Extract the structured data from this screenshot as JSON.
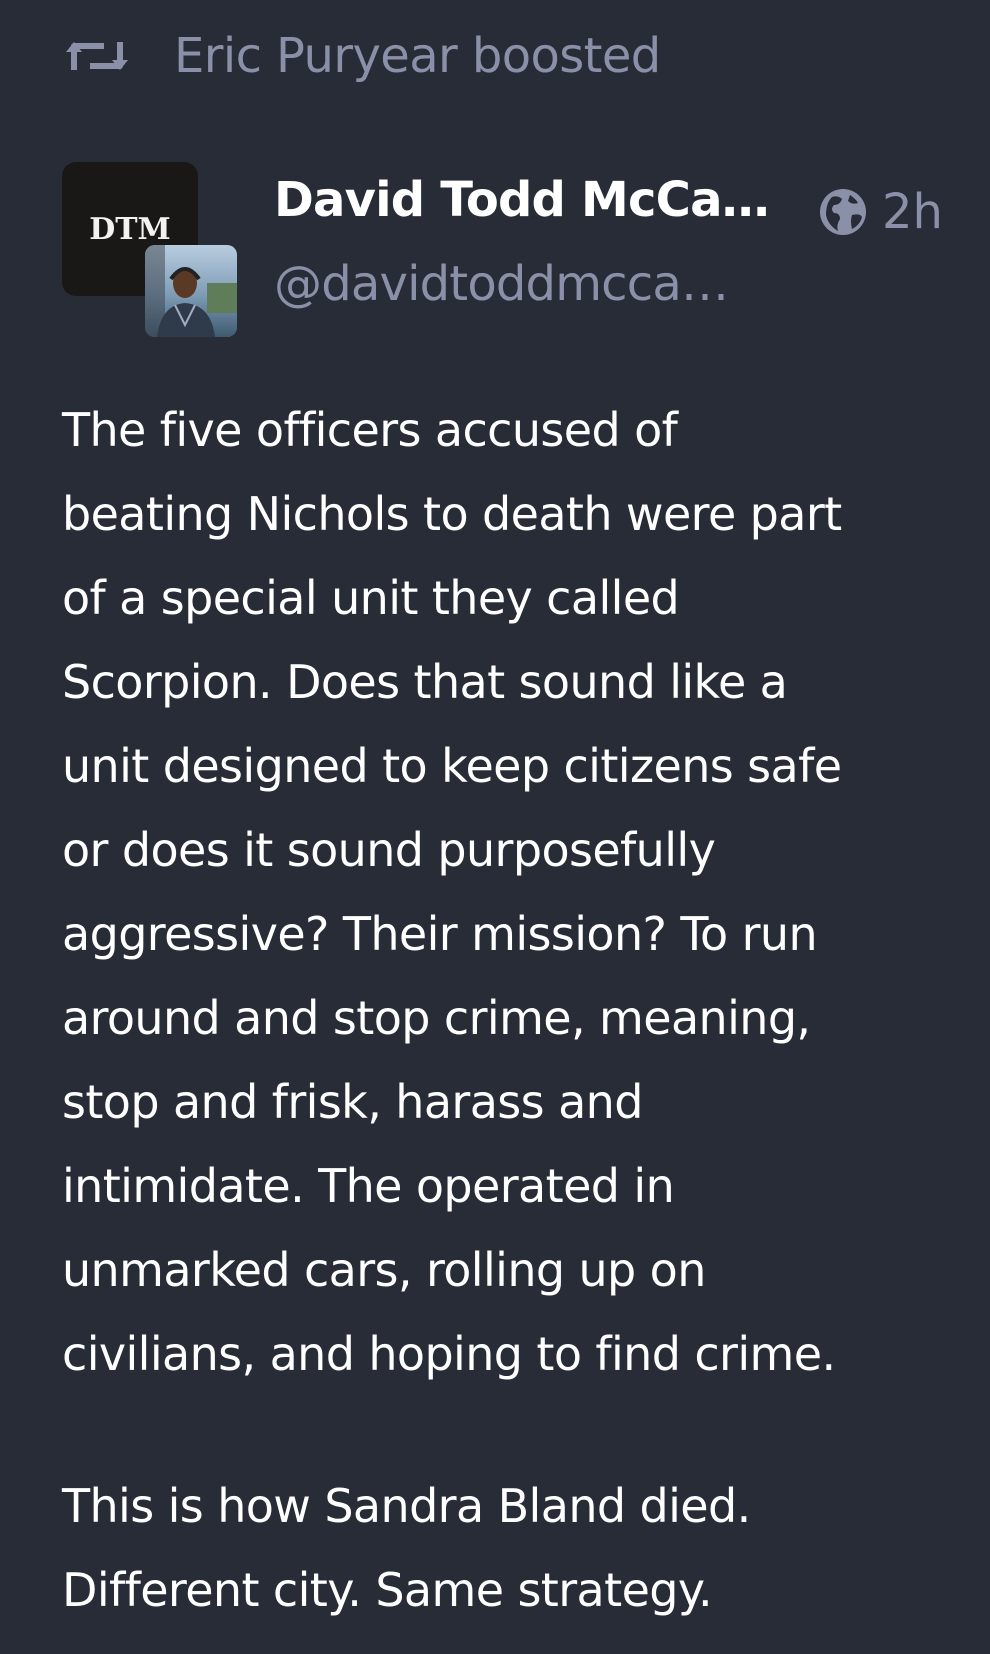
{
  "boost": {
    "icon": "boost-icon",
    "text": "Eric Puryear boosted"
  },
  "account": {
    "avatar_logo_text": "DTM",
    "display_name": "David Todd McCa…",
    "handle": "@davidtoddmcca…"
  },
  "meta": {
    "visibility_icon": "globe-icon",
    "relative_time": "2h"
  },
  "status": {
    "paragraph_1": "The five officers accused of\nbeating Nichols to death were part\nof a special unit they called\nScorpion. Does that sound like a\nunit designed to keep citizens safe\nor does it sound purposefully\naggressive? Their mission? To run\naround and stop crime, meaning,\nstop and frisk, harass and\nintimidate. The operated in\nunmarked cars, rolling up on\ncivilians, and hoping to find crime.",
    "paragraph_2": "This is how Sandra Bland died.\nDifferent city. Same strategy."
  },
  "colors": {
    "background": "#282c37",
    "primary_text": "#ffffff",
    "secondary_text": "#8a90a8"
  }
}
